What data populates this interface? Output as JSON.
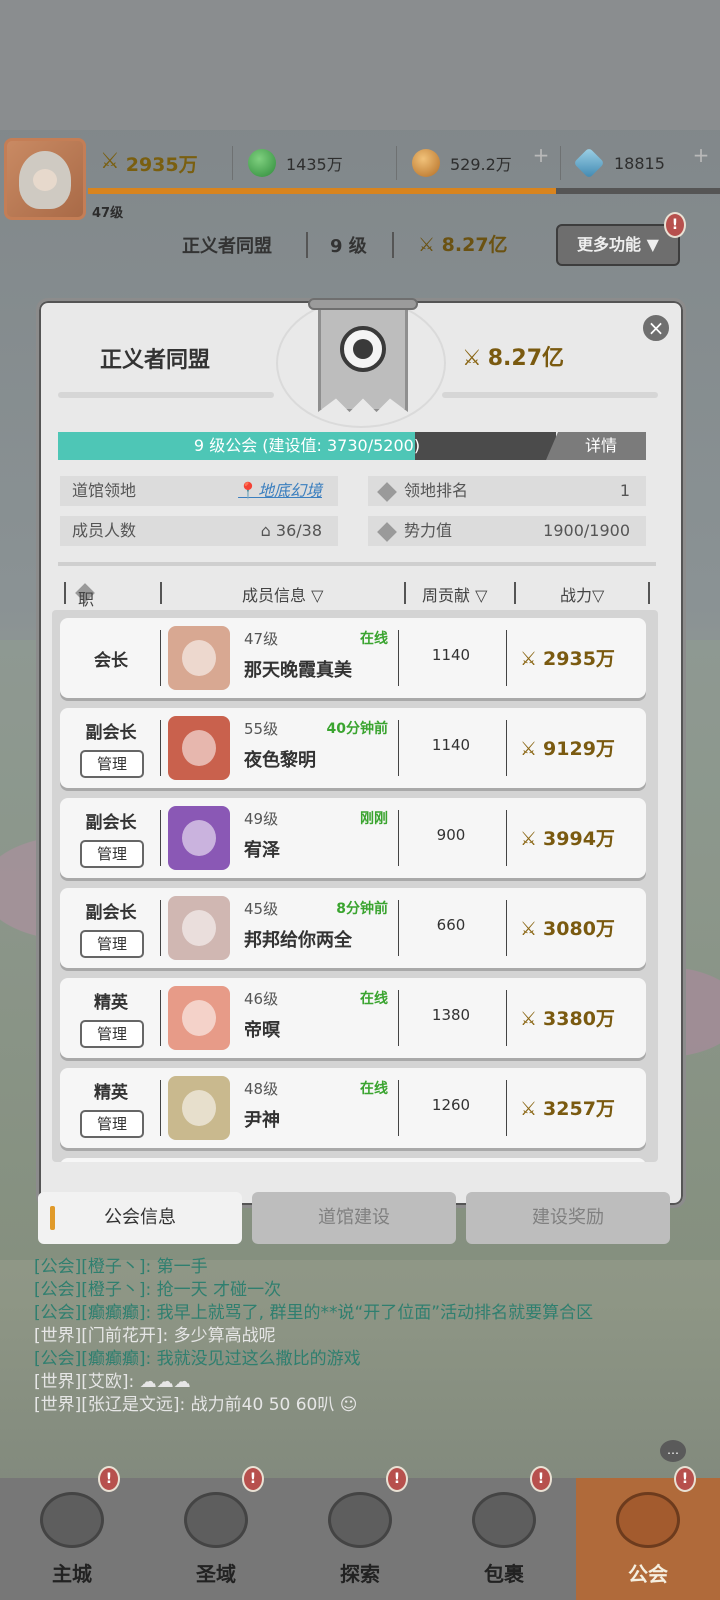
{
  "player": {
    "level": "47级",
    "power": "2935万",
    "green_currency": "1435万",
    "gold_currency": "529.2万",
    "diamonds": "18815",
    "xp_fill": 0.74
  },
  "guild_bar": {
    "name": "正义者同盟",
    "level": "9 级",
    "power": "8.27亿",
    "more_button": "更多功能 ▼",
    "alert": "!"
  },
  "panel": {
    "name": "正义者同盟",
    "power": "8.27亿",
    "close": "×",
    "level_text": "9 级公会 (建设值:  3730/5200)",
    "level_fill": 0.717,
    "detail_button": "详情",
    "info": {
      "territory_label": "道馆领地",
      "territory_value": "地底幻境",
      "rank_label": "领地排名",
      "rank_value": "1",
      "members_label": "成员人数",
      "members_value": "36/38",
      "influence_label": "势力值",
      "influence_value": "1900/1900"
    },
    "columns": {
      "position": "职位",
      "member_info": "成员信息 ▽",
      "weekly": "周贡献 ▽",
      "power": "战力▽"
    },
    "manage_label": "管理",
    "members": [
      {
        "role": "会长",
        "level": "47级",
        "status": "在线",
        "name": "那天晚霞真美",
        "contrib": "1140",
        "power": "2935万",
        "avatar_color": "#d8a892"
      },
      {
        "role": "副会长",
        "level": "55级",
        "status": "40分钟前",
        "name": "夜色黎明",
        "contrib": "1140",
        "power": "9129万",
        "avatar_color": "#c9614d"
      },
      {
        "role": "副会长",
        "level": "49级",
        "status": "刚刚",
        "name": "宥泽",
        "contrib": "900",
        "power": "3994万",
        "avatar_color": "#8a58b5"
      },
      {
        "role": "副会长",
        "level": "45级",
        "status": "8分钟前",
        "name": "邦邦给你两全",
        "contrib": "660",
        "power": "3080万",
        "avatar_color": "#d0b7b2"
      },
      {
        "role": "精英",
        "level": "46级",
        "status": "在线",
        "name": "帝暝",
        "contrib": "1380",
        "power": "3380万",
        "avatar_color": "#e79b88"
      },
      {
        "role": "精英",
        "level": "48级",
        "status": "在线",
        "name": "尹神",
        "contrib": "1260",
        "power": "3257万",
        "avatar_color": "#c9b98e"
      }
    ]
  },
  "tabs": [
    {
      "label": "公会信息",
      "active": true
    },
    {
      "label": "道馆建设",
      "active": false
    },
    {
      "label": "建设奖励",
      "active": false
    }
  ],
  "chat": [
    {
      "channel": "guild",
      "text": "[公会][橙子丶]: 第一手"
    },
    {
      "channel": "guild",
      "text": "[公会][橙子丶]: 抢一天  才碰一次"
    },
    {
      "channel": "guild",
      "text": "[公会][癫癫癫]: 我早上就骂了, 群里的**说“开了位面”活动排名就要算合区"
    },
    {
      "channel": "world",
      "text": "[世界][门前花开]: 多少算高战呢"
    },
    {
      "channel": "guild",
      "text": "[公会][癫癫癫]: 我就没见过这么撒比的游戏"
    },
    {
      "channel": "world",
      "text": "[世界][艾欧]:  ☁☁☁"
    },
    {
      "channel": "world",
      "text": "[世界][张辽是文远]: 战力前40 50 60叭 ☺"
    }
  ],
  "nav": [
    {
      "label": "主城",
      "active": false
    },
    {
      "label": "圣域",
      "active": false
    },
    {
      "label": "探索",
      "active": false
    },
    {
      "label": "包裹",
      "active": false
    },
    {
      "label": "公会",
      "active": true
    }
  ]
}
